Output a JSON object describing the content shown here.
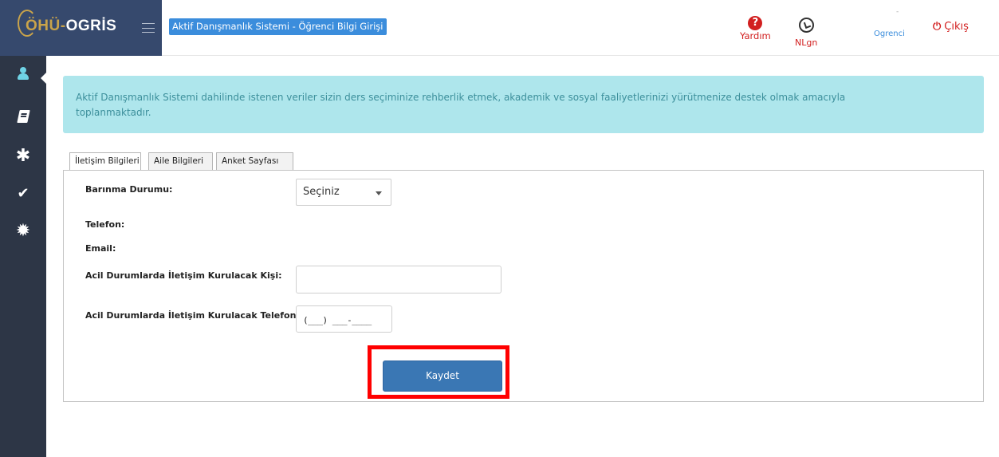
{
  "header": {
    "logo_part1": "ÖHÜ-",
    "logo_part2": "OGRİS",
    "page_title": "Aktif Danışmanlık Sistemi - Öğrenci Bilgi Girişi",
    "help_label": "Yardım",
    "help_icon": "question-circle-icon",
    "nlgn_label": "NLgn",
    "nlgn_icon": "clock-refresh-icon",
    "user_dash": "-",
    "user_role": "Ogrenci",
    "logout_label": "Çıkış",
    "accent_color": "#d21f1f"
  },
  "sidebar": {
    "items": [
      {
        "icon": "user-icon",
        "active": true
      },
      {
        "icon": "book-icon",
        "active": false
      },
      {
        "icon": "asterisk-icon",
        "active": false
      },
      {
        "icon": "check-icon",
        "active": false
      },
      {
        "icon": "gear-icon",
        "active": false
      }
    ]
  },
  "info": {
    "line1": "Aktif Danışmanlık Sistemi dahilinde istenen veriler sizin ders seçiminize rehberlik etmek, akademik ve sosyal faaliyetlerinizi yürütmenize destek olmak amacıyla",
    "line2": "toplanmaktadır."
  },
  "tabs": [
    {
      "label": "İletişim Bilgileri",
      "active": true
    },
    {
      "label": "Aile Bilgileri",
      "active": false
    },
    {
      "label": "Anket Sayfası",
      "active": false
    }
  ],
  "form": {
    "housing_label": "Barınma Durumu:",
    "housing_value": "Seçiniz",
    "phone_label": "Telefon:",
    "email_label": "Email:",
    "emergency_contact_label": "Acil Durumlarda İletişim Kurulacak Kişi:",
    "emergency_contact_value": "",
    "emergency_phone_label": "Acil Durumlarda İletişim Kurulacak Telefon:",
    "emergency_phone_mask": "(___) ___-____",
    "save_label": "Kaydet"
  }
}
